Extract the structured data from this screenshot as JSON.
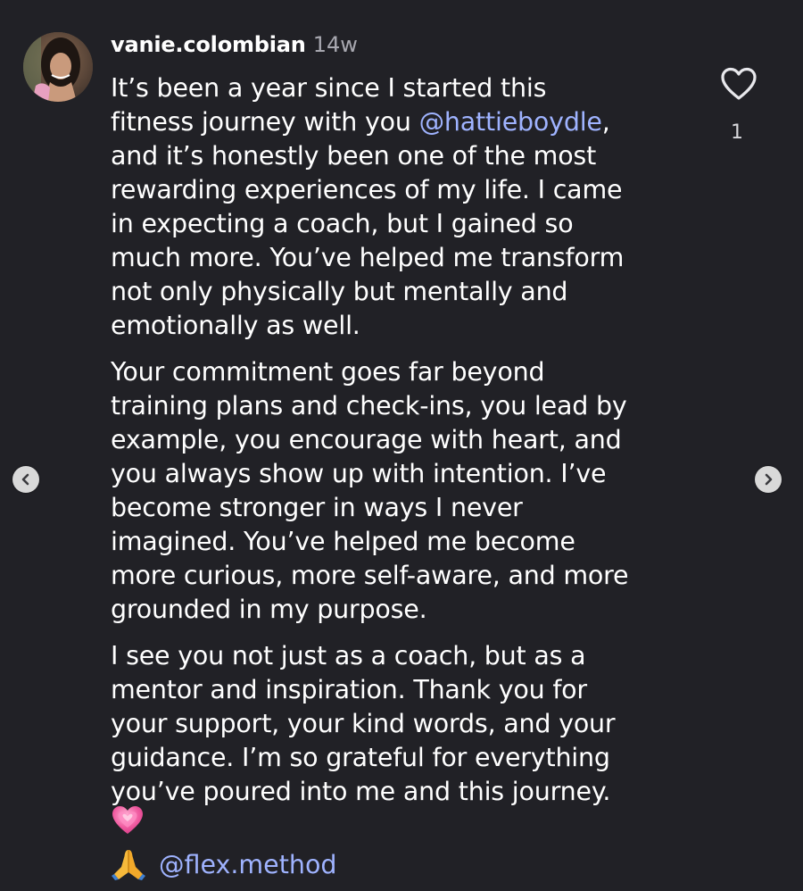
{
  "comment": {
    "username": "vanie.colombian",
    "timestamp": "14w",
    "paragraph1_lines": [
      "It’s been a year since I started this",
      "fitness journey with you ",
      "and it’s honestly been one of the most",
      "rewarding experiences of my life. I came",
      "in expecting a coach, but I gained so",
      "much more. You’ve helped me transform",
      "not only physically but mentally and",
      "emotionally as well."
    ],
    "mention1": "@hattieboydle",
    "mention1_suffix": ",",
    "paragraph2_lines": [
      "Your commitment goes far beyond",
      "training plans and check-ins, you lead by",
      "example, you encourage with heart, and",
      "you always show up with intention. I’ve",
      "become stronger in ways I never",
      "imagined. You’ve helped me become",
      "more curious, more self-aware, and more",
      "grounded in my purpose."
    ],
    "paragraph3_lines": [
      "I see you not just as a coach, but as a",
      "mentor and inspiration. Thank you for",
      "your support, your kind words, and your",
      "guidance. I’m so grateful for everything",
      "you’ve poured into me and this journey."
    ],
    "emoji_heart": "growing-heart-icon",
    "emoji_pray": "praying-hands-icon",
    "mention2": "@flex.method"
  },
  "likes": {
    "icon": "heart-outline-icon",
    "count": "1"
  },
  "navigation": {
    "prev_icon": "chevron-left-icon",
    "next_icon": "chevron-right-icon"
  },
  "colors": {
    "background": "#212126",
    "text": "#ffffff",
    "mention": "#9fb3ff",
    "timestamp": "#a8a8b0"
  }
}
